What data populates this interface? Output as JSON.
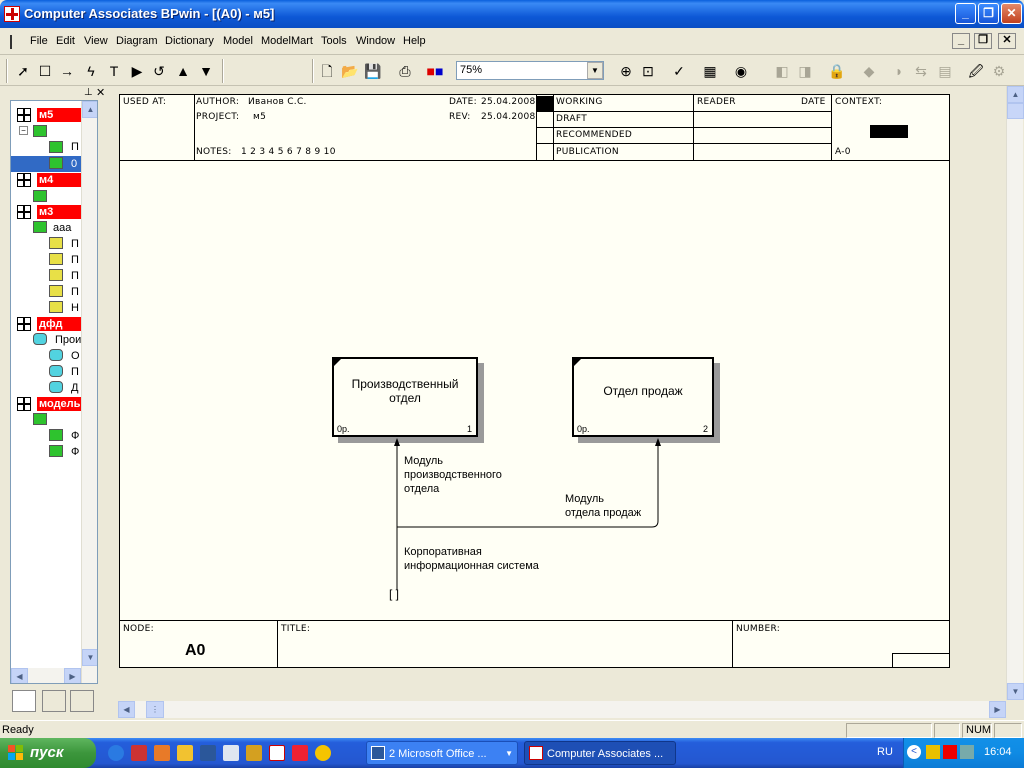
{
  "window": {
    "title": "Computer Associates BPwin - [(A0)  - м5]",
    "controls": {
      "minimize": "_",
      "maximize": "❐",
      "close": "✕"
    }
  },
  "menu": [
    "File",
    "Edit",
    "View",
    "Diagram",
    "Dictionary",
    "Model",
    "ModelMart",
    "Tools",
    "Window",
    "Help"
  ],
  "toolbar": {
    "zoom_value": "75%",
    "tools": [
      "pointer-icon",
      "box-icon",
      "arrow-icon",
      "squiggle-icon",
      "text-icon",
      "triangle-right-icon",
      "undo-icon",
      "up-icon",
      "down-icon",
      "new-icon",
      "open-icon",
      "save-icon",
      "print-icon",
      "color-icon"
    ]
  },
  "tree": {
    "models": [
      {
        "name": "м5"
      },
      {
        "name": "м4"
      },
      {
        "name": "м3"
      },
      {
        "name": "дфд"
      },
      {
        "name": "модель"
      }
    ],
    "items": {
      "m5_child1": "П",
      "m5_child2": "0",
      "m3_root": "ааа",
      "m3_c1": "П",
      "m3_c2": "П",
      "m3_c3": "П",
      "m3_c4": "П",
      "m3_c5": "Н",
      "dfd_root": "Прои",
      "dfd_c1": "О",
      "dfd_c2": "П",
      "dfd_c3": "Д",
      "model_c1": "Ф",
      "model_c2": "Ф"
    }
  },
  "diagram": {
    "header": {
      "used_at": "USED AT:",
      "author_label": "AUTHOR:",
      "author": "Иванов С.С.",
      "project_label": "PROJECT:",
      "project": "м5",
      "date_label": "DATE:",
      "date": "25.04.2008",
      "rev_label": "REV:",
      "rev": "25.04.2008",
      "notes_label": "NOTES:",
      "notes": "1  2  3  4  5  6  7  8  9  10",
      "working": "WORKING",
      "draft": "DRAFT",
      "recommended": "RECOMMENDED",
      "publication": "PUBLICATION",
      "reader": "READER",
      "date_col": "DATE",
      "context": "CONTEXT:",
      "context_node": "A-0"
    },
    "boxes": [
      {
        "title": "Производственный отдел",
        "cost": "0р.",
        "number": "1"
      },
      {
        "title": "Отдел продаж",
        "cost": "0р.",
        "number": "2"
      }
    ],
    "arrows": {
      "a1": "Модуль производственного отдела",
      "a1_l1": "Модуль",
      "a1_l2": "производственного",
      "a1_l3": "отдела",
      "a2_l1": "Модуль",
      "a2_l2": "отдела продаж",
      "a3_l1": "Корпоративная",
      "a3_l2": "информационная система",
      "tunnel": "[ ]"
    },
    "footer": {
      "node_label": "NODE:",
      "node": "A0",
      "title_label": "TITLE:",
      "number_label": "NUMBER:"
    }
  },
  "status": {
    "text": "Ready",
    "num": "NUM"
  },
  "taskbar": {
    "start": "пуск",
    "tasks": [
      "2 Microsoft Office ...",
      "Computer Associates ..."
    ],
    "lang": "RU",
    "clock": "16:04"
  }
}
